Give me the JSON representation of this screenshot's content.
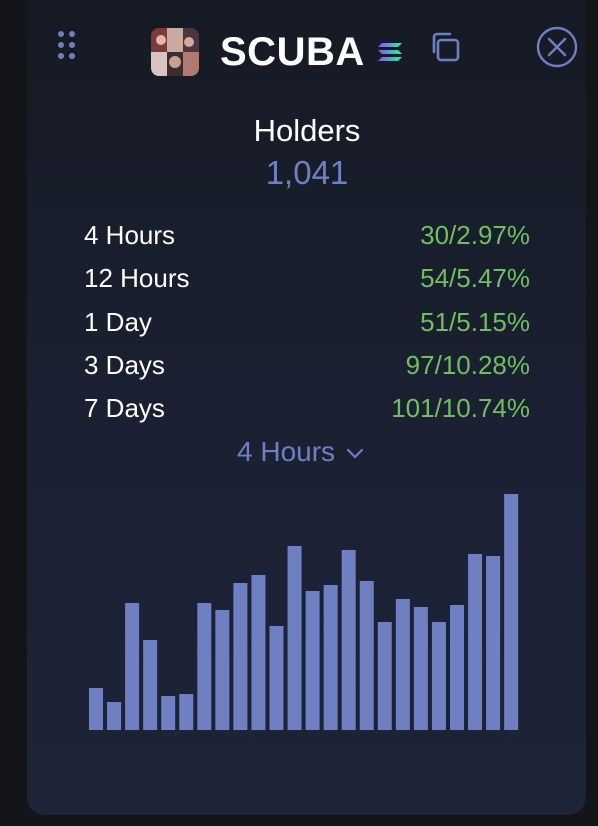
{
  "header": {
    "token_name": "SCUBA",
    "icons": {
      "drag": "drag-handle-icon",
      "chain": "solana-icon",
      "copy": "copy-icon",
      "close": "close-icon"
    }
  },
  "holders": {
    "title": "Holders",
    "count": "1,041"
  },
  "stats": [
    {
      "label": "4 Hours",
      "value": "30/2.97%"
    },
    {
      "label": "12 Hours",
      "value": "54/5.47%"
    },
    {
      "label": "1 Day",
      "value": "51/5.15%"
    },
    {
      "label": "3 Days",
      "value": "97/10.28%"
    },
    {
      "label": "7 Days",
      "value": "101/10.74%"
    }
  ],
  "period_select": {
    "selected": "4 Hours"
  },
  "colors": {
    "accent": "#6c80c4",
    "positive": "#6fbf5f",
    "bar": "#6e7fc2",
    "text": "#ffffff"
  },
  "chart_data": {
    "type": "bar",
    "values": [
      42,
      28,
      127,
      90,
      34,
      36,
      127,
      120,
      147,
      155,
      104,
      184,
      139,
      145,
      180,
      149,
      108,
      131,
      123,
      108,
      125,
      176,
      174,
      236
    ],
    "ylim": [
      0,
      236
    ],
    "grid": false,
    "legend": "none"
  }
}
